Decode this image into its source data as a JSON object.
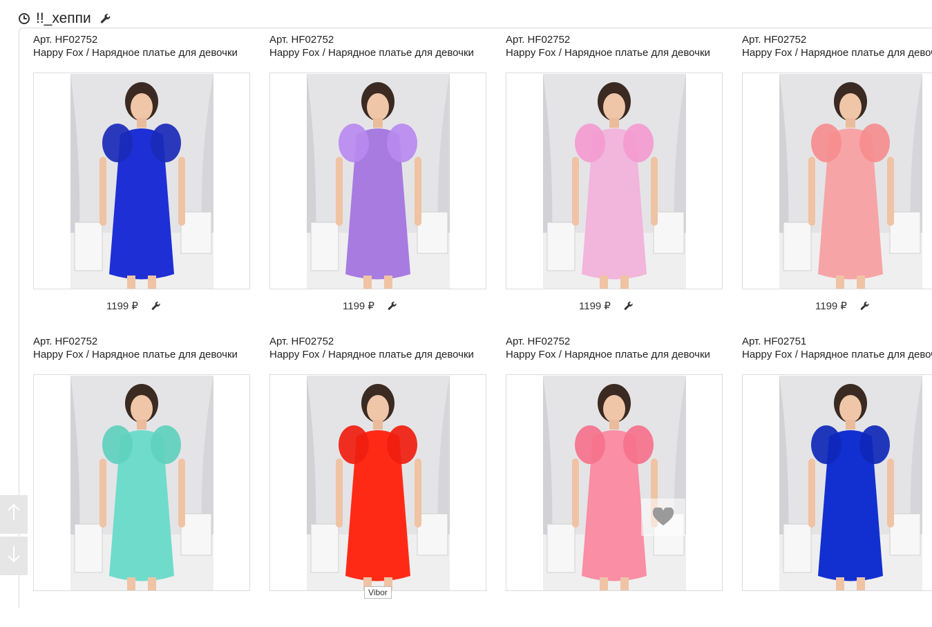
{
  "header": {
    "title": "!!_хеппи"
  },
  "products": [
    {
      "art": "Арт. HF02752",
      "name": "Happy Fox / Нарядное платье для девочки",
      "price": "1199 ₽",
      "dress_color": "#1f2fd6",
      "sleeve_color": "#1a2ab8"
    },
    {
      "art": "Арт. HF02752",
      "name": "Happy Fox / Нарядное платье для девочки",
      "price": "1199 ₽",
      "dress_color": "#a77be0",
      "sleeve_color": "#b98af0"
    },
    {
      "art": "Арт. HF02752",
      "name": "Happy Fox / Нарядное платье для девочки",
      "price": "1199 ₽",
      "dress_color": "#f2b5dc",
      "sleeve_color": "#f39bd0"
    },
    {
      "art": "Арт. HF02752",
      "name": "Happy Fox / Нарядное платье для девочки",
      "price": "1199 ₽",
      "dress_color": "#f7a4a6",
      "sleeve_color": "#f68d8f"
    },
    {
      "art": "Арт. HF02752",
      "name": "Happy Fox / Нарядное платье для девочки",
      "price": "",
      "dress_color": "#6fdccb",
      "sleeve_color": "#5fd0bd"
    },
    {
      "art": "Арт. HF02752",
      "name": "Happy Fox / Нарядное платье для девочки",
      "price": "",
      "dress_color": "#ff2a16",
      "sleeve_color": "#f01e10"
    },
    {
      "art": "Арт. HF02752",
      "name": "Happy Fox / Нарядное платье для девочки",
      "price": "",
      "dress_color": "#f98ea4",
      "sleeve_color": "#f5728c"
    },
    {
      "art": "Арт. HF02751",
      "name": "Happy Fox / Нарядное платье для девочки",
      "price": "",
      "dress_color": "#1230d0",
      "sleeve_color": "#0f28b8"
    }
  ],
  "tooltip": {
    "text": "Vibor"
  },
  "icons": {
    "header_left": "clock-icon",
    "header_right": "wrench-icon",
    "price_action": "wrench-icon",
    "scroll_up": "arrow-up-icon",
    "scroll_down": "arrow-down-icon",
    "favorite": "heart-icon"
  }
}
